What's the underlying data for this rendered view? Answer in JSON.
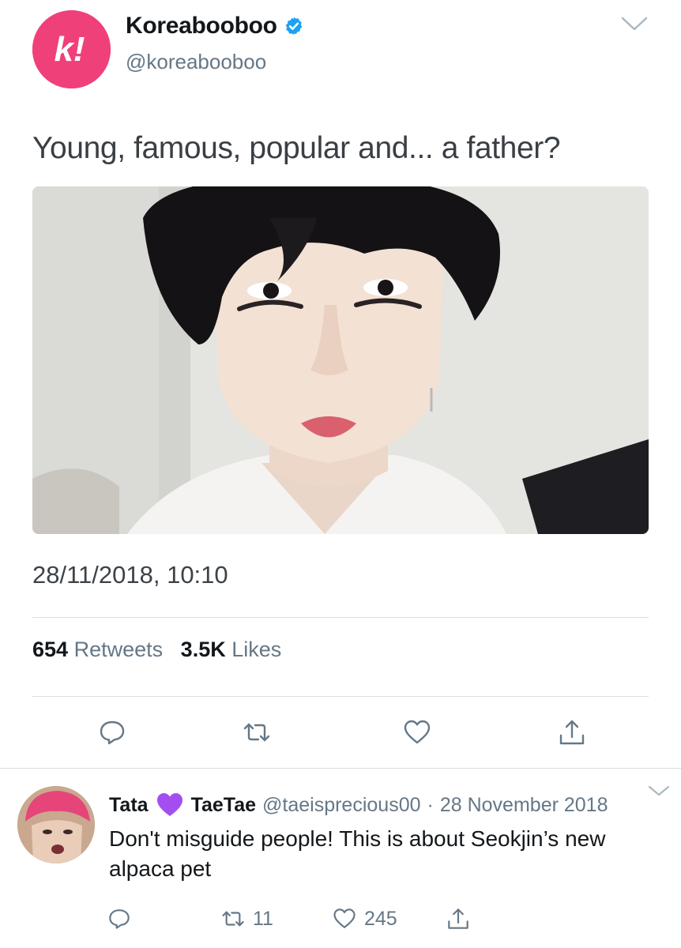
{
  "tweet": {
    "display_name": "Koreabooboo",
    "handle": "@koreabooboo",
    "verified_icon": "verified-badge-icon",
    "avatar_letter": "k!",
    "brand_color": "#f0407a",
    "text": "Young, famous, popular and... a father?",
    "timestamp": "28/11/2018, 10:10",
    "retweet_count": "654",
    "retweet_label": "Retweets",
    "like_count": "3.5K",
    "like_label": "Likes"
  },
  "actions": {
    "reply_icon": "reply-icon",
    "retweet_icon": "retweet-icon",
    "like_icon": "heart-icon",
    "share_icon": "share-icon"
  },
  "reply": {
    "name_part1": "Tata",
    "emoji": "purple-heart-emoji",
    "name_part2": "TaeTae",
    "handle": "@taeisprecious00",
    "date": "28 November 2018",
    "text": "Don't misguide people! This is about Seokjin’s new alpaca pet",
    "retweet_count": "11",
    "like_count": "245"
  },
  "colors": {
    "secondary_text": "#657786",
    "divider": "#d7dee3",
    "verified_blue": "#1da1f2",
    "emoji_purple": "#a34ff0"
  }
}
